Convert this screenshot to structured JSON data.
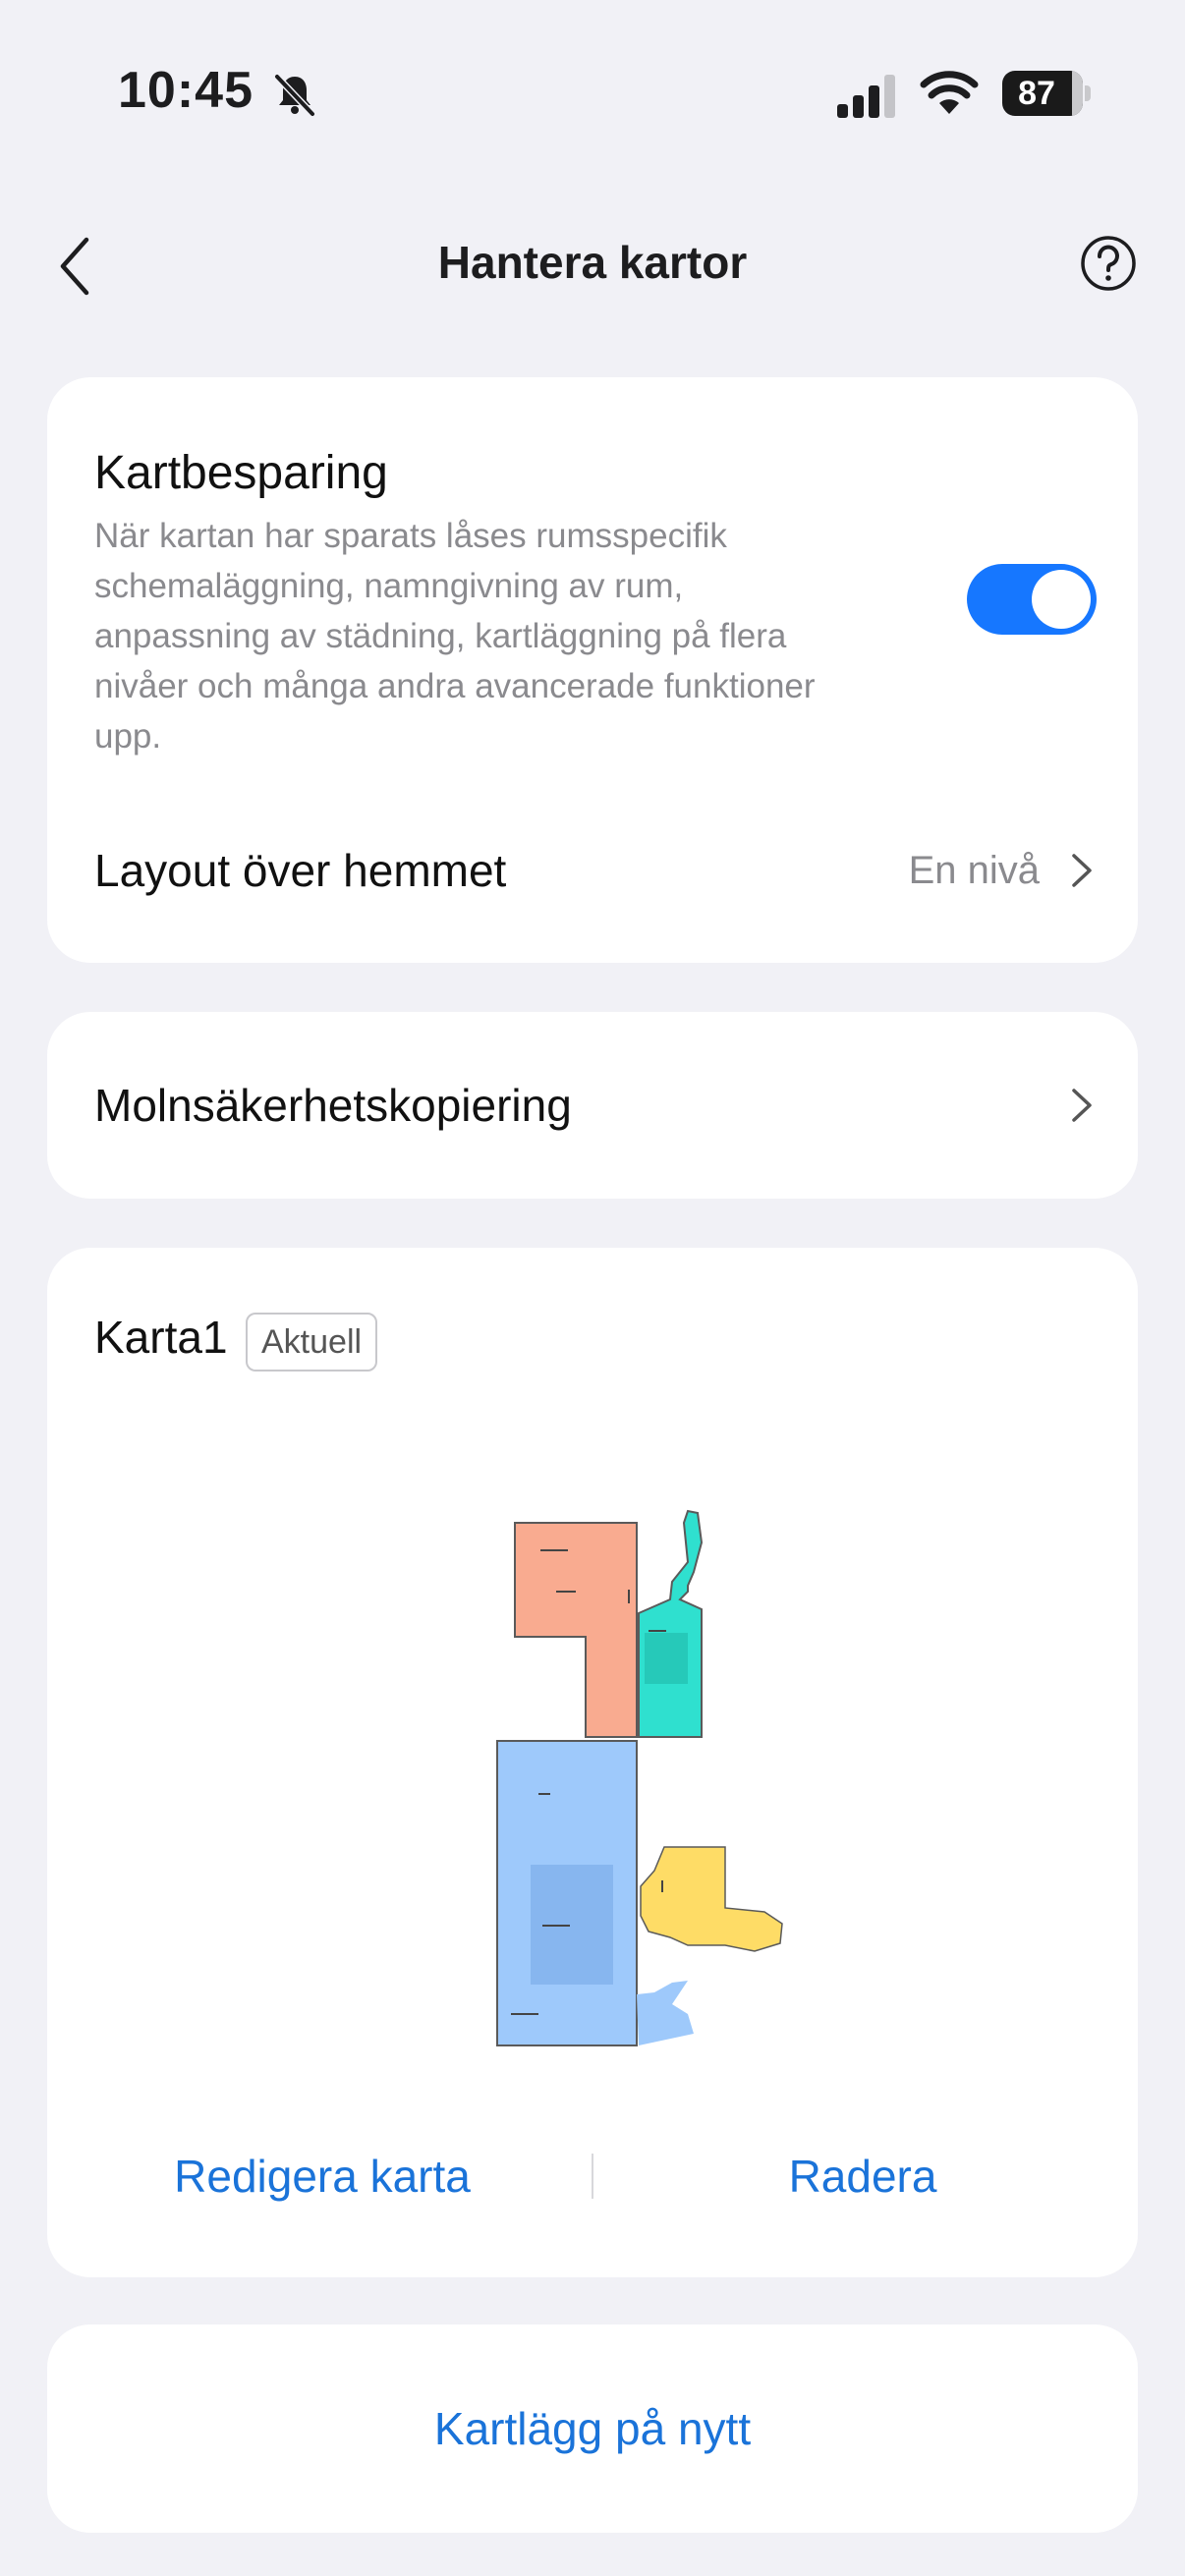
{
  "status_bar": {
    "time": "10:45",
    "battery": "87",
    "battery_level": 0.87,
    "icons": [
      "bell-slash-icon",
      "cellular-signal-icon",
      "wifi-icon",
      "battery-icon"
    ]
  },
  "nav": {
    "title": "Hantera kartor",
    "back_icon": "chevron-left-icon",
    "help_icon": "question-circle-icon"
  },
  "map_saving": {
    "title": "Kartbesparing",
    "description": "När kartan har sparats låses rumsspecifik schemaläggning, namngivning av rum, anpassning av städning, kartläggning på flera nivåer och många andra avancerade funktioner upp.",
    "toggle_on": true,
    "accent_color": "#1677ff",
    "layout_label": "Layout över hemmet",
    "layout_value": "En nivå"
  },
  "cloud_backup": {
    "label": "Molnsäkerhetskopiering"
  },
  "map": {
    "name": "Karta1",
    "badge": "Aktuell",
    "room_colors": [
      "#f9ab90",
      "#2fe0cf",
      "#9ec9fb",
      "#fedc66"
    ],
    "edit_label": "Redigera karta",
    "delete_label": "Radera",
    "action_color": "#1a73d9"
  },
  "remap": {
    "label": "Kartlägg på nytt"
  }
}
